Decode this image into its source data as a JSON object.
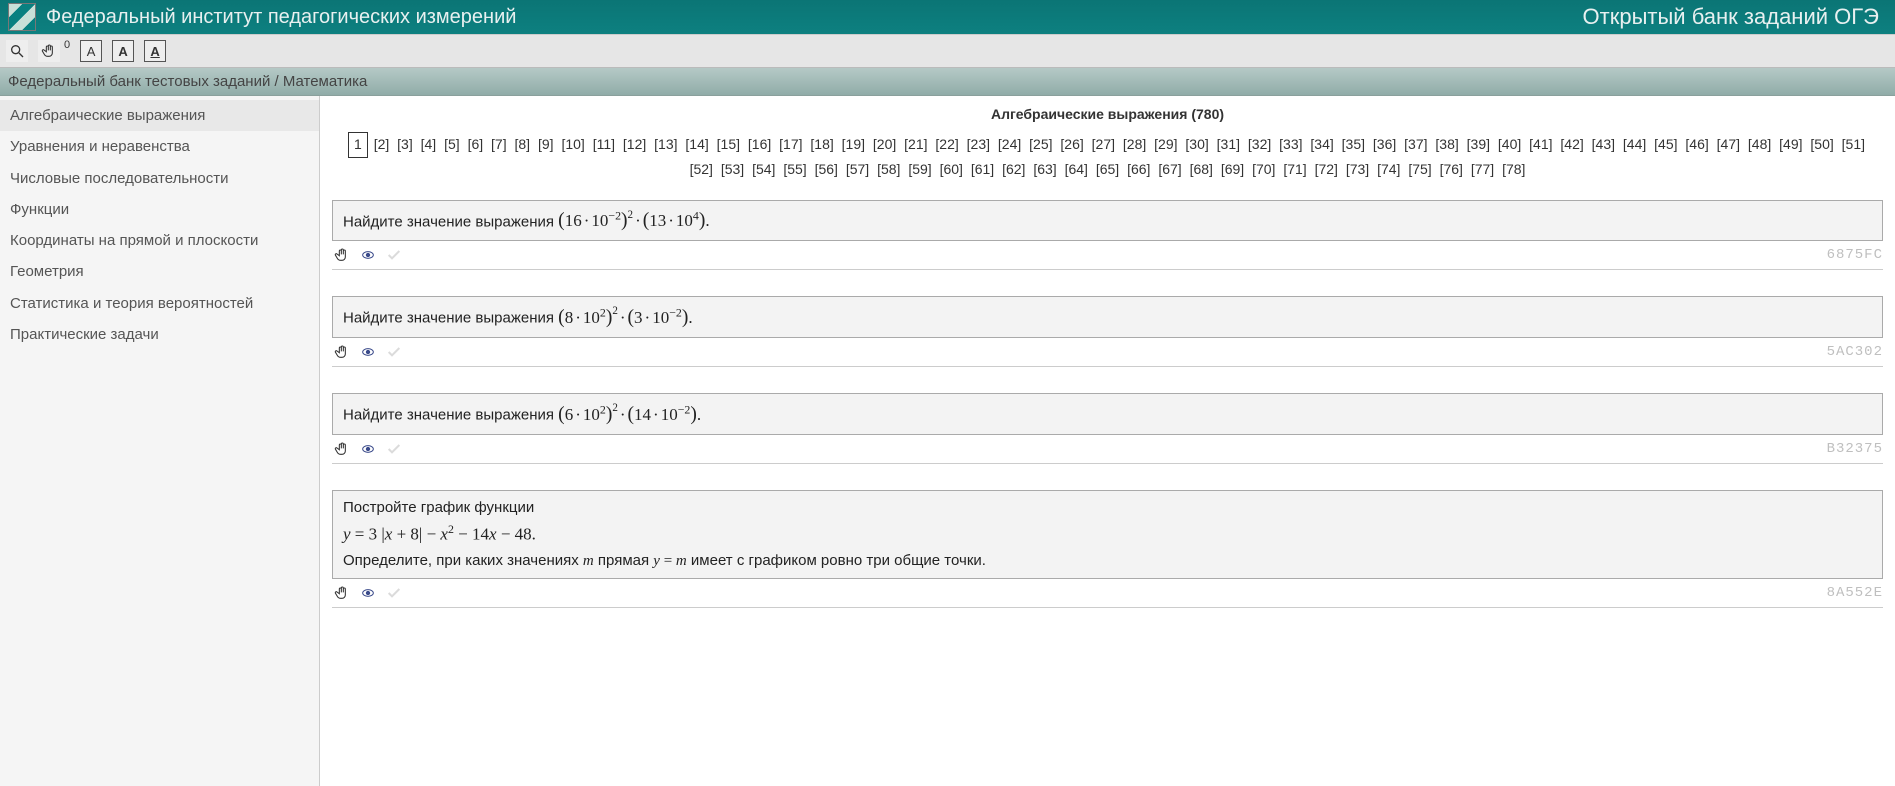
{
  "header": {
    "title_left": "Федеральный институт педагогических измерений",
    "title_right": "Открытый банк заданий ОГЭ"
  },
  "toolbar": {
    "search_icon": "search-icon",
    "hand_icon": "hand-icon",
    "hand_count": "0",
    "font_a": "A",
    "font_b": "А",
    "font_c": "А"
  },
  "breadcrumb": "Федеральный банк тестовых заданий / Математика",
  "sidebar": {
    "items": [
      {
        "label": "Алгебраические выражения",
        "active": true
      },
      {
        "label": "Уравнения и неравенства",
        "active": false
      },
      {
        "label": "Числовые последовательности",
        "active": false
      },
      {
        "label": "Функции",
        "active": false
      },
      {
        "label": "Координаты на прямой и плоскости",
        "active": false
      },
      {
        "label": "Геометрия",
        "active": false
      },
      {
        "label": "Статистика и теория вероятностей",
        "active": false
      },
      {
        "label": "Практические задачи",
        "active": false
      }
    ]
  },
  "section": {
    "title": "Алгебраические выражения (780)"
  },
  "pager": {
    "current": 1,
    "total": 78
  },
  "tasks": [
    {
      "prefix": "Найдите значение выражения ",
      "expr_html": "<span class='paren'>(</span>16<span class='dot'>·</span>10<span class='sup'>−2</span><span class='paren'>)</span><span class='sup2'>2</span><span class='dot'>·</span><span class='paren'>(</span>13<span class='dot'>·</span>10<span class='sup'>4</span><span class='paren'>)</span>.",
      "id": "6875FC"
    },
    {
      "prefix": "Найдите значение выражения ",
      "expr_html": "<span class='paren'>(</span>8<span class='dot'>·</span>10<span class='sup'>2</span><span class='paren'>)</span><span class='sup2'>2</span><span class='dot'>·</span><span class='paren'>(</span>3<span class='dot'>·</span>10<span class='sup'>−2</span><span class='paren'>)</span>.",
      "id": "5AC302"
    },
    {
      "prefix": "Найдите значение выражения ",
      "expr_html": "<span class='paren'>(</span>6<span class='dot'>·</span>10<span class='sup'>2</span><span class='paren'>)</span><span class='sup2'>2</span><span class='dot'>·</span><span class='paren'>(</span>14<span class='dot'>·</span>10<span class='sup'>−2</span><span class='paren'>)</span>.",
      "id": "B32375"
    },
    {
      "line1": "Постройте график функции",
      "expr_html": "<span class='mi'>y</span> = 3 |<span class='mi'>x</span> + 8| − <span class='mi'>x</span><span class='sup'>2</span> − 14<span class='mi'>x</span> − 48.",
      "line3_a": "Определите, при каких значениях ",
      "line3_m1": "m",
      "line3_b": " прямая ",
      "line3_eq": "y = m",
      "line3_c": " имеет с графиком ровно три общие точки.",
      "id": "8A552E"
    }
  ]
}
